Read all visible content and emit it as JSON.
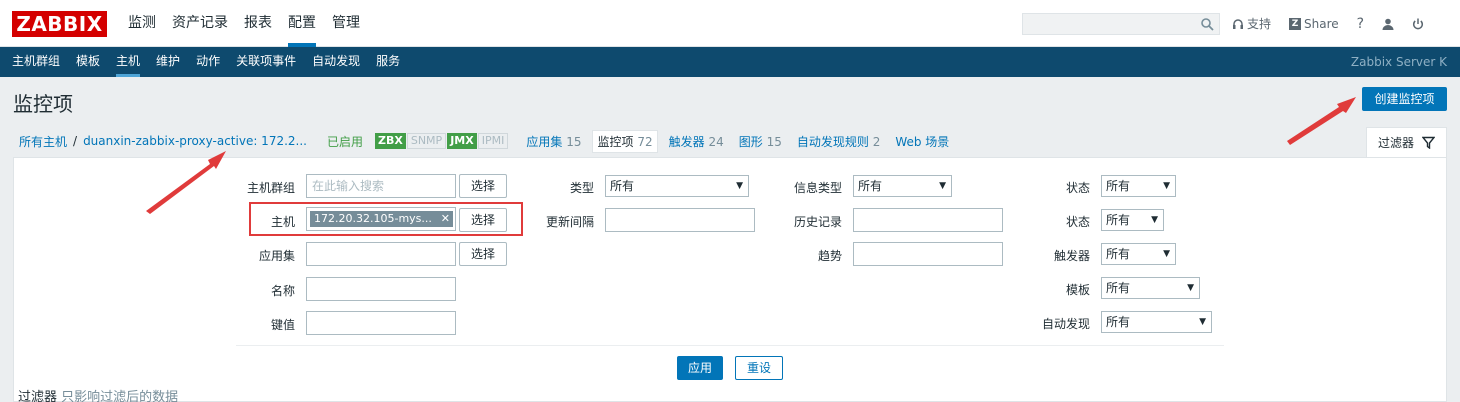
{
  "logo": "ZABBIX",
  "main_menu": [
    "监测",
    "资产记录",
    "报表",
    "配置",
    "管理"
  ],
  "main_menu_active": "配置",
  "top_links": {
    "support": "支持",
    "share": "Share",
    "help": "?"
  },
  "sub_menu": [
    "主机群组",
    "模板",
    "主机",
    "维护",
    "动作",
    "关联项事件",
    "自动发现",
    "服务"
  ],
  "sub_menu_active": "主机",
  "server_name": "Zabbix Server K",
  "page_title": "监控项",
  "create_button": "创建监控项",
  "breadcrumb": {
    "all_hosts": "所有主机",
    "separator": "/",
    "host": "duanxin-zabbix-proxy-active: 172.2...",
    "status": "已启用",
    "interfaces": [
      "ZBX",
      "SNMP",
      "JMX",
      "IPMI"
    ],
    "tabs": [
      {
        "label": "应用集",
        "count": "15"
      },
      {
        "label": "监控项",
        "count": "72"
      },
      {
        "label": "触发器",
        "count": "24"
      },
      {
        "label": "图形",
        "count": "15"
      },
      {
        "label": "自动发现规则",
        "count": "2"
      },
      {
        "label": "Web 场景",
        "count": ""
      }
    ]
  },
  "filter_tab_label": "过滤器",
  "filter": {
    "col1": {
      "host_group_label": "主机群组",
      "host_group_placeholder": "在此输入搜索",
      "host_label": "主机",
      "host_chip": "172.20.32.105-mys...",
      "app_label": "应用集",
      "name_label": "名称",
      "key_label": "键值",
      "select_button": "选择"
    },
    "col2": {
      "type_label": "类型",
      "type_value": "所有",
      "interval_label": "更新间隔"
    },
    "col3": {
      "info_type_label": "信息类型",
      "info_type_value": "所有",
      "history_label": "历史记录",
      "trends_label": "趋势"
    },
    "col4": {
      "state_label": "状态",
      "state_value": "所有",
      "status_label": "状态",
      "status_value": "所有",
      "triggers_label": "触发器",
      "triggers_value": "所有",
      "template_label": "模板",
      "template_value": "所有",
      "discovery_label": "自动发现",
      "discovery_value": "所有"
    },
    "apply_button": "应用",
    "reset_button": "重设"
  },
  "footer": {
    "bold": "过滤器",
    "muted": "只影响过滤后的数据"
  },
  "colors": {
    "accent": "#0275b8",
    "brand": "#d40000",
    "nav": "#0e4a6e",
    "enabled": "#429e47",
    "annotation": "#e03b3b"
  }
}
